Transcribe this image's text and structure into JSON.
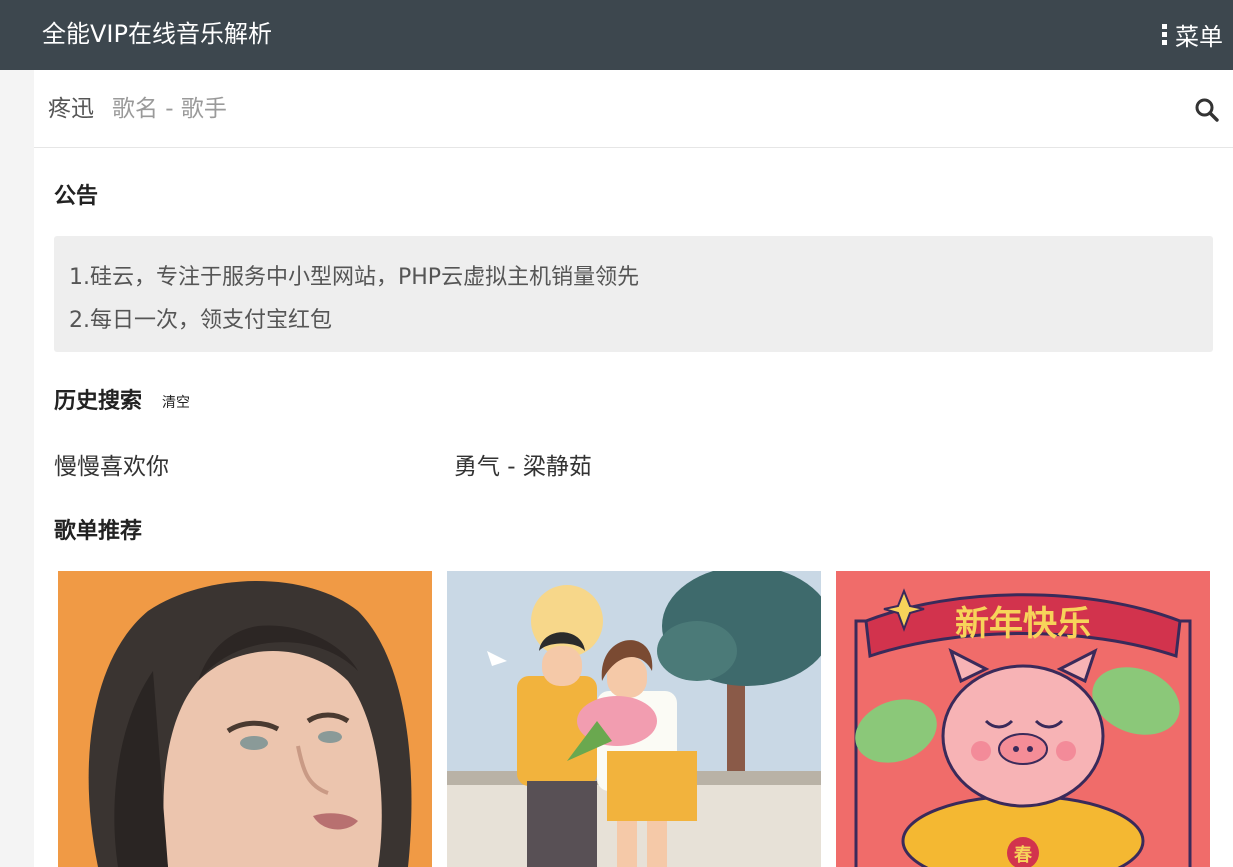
{
  "header": {
    "title": "全能VIP在线音乐解析",
    "menu_label": "菜单"
  },
  "search": {
    "source": "疼迅",
    "placeholder": "歌名 - 歌手"
  },
  "notice": {
    "title": "公告",
    "lines": [
      "1.硅云，专注于服务中小型网站，PHP云虚拟主机销量领先",
      "2.每日一次，领支付宝红包"
    ]
  },
  "history": {
    "title": "历史搜索",
    "clear_label": "清空",
    "items": [
      "慢慢喜欢你",
      "勇气 - 梁静茹"
    ]
  },
  "playlists": {
    "title": "歌单推荐",
    "covers": [
      {
        "image": "portrait-orange-background"
      },
      {
        "image": "couple-illustration"
      },
      {
        "image": "new-year-pig",
        "banner_text": "新年快乐",
        "stamp_text": "春"
      }
    ]
  },
  "colors": {
    "topbar": "#3d474e",
    "notice_bg": "#eeeeee"
  }
}
